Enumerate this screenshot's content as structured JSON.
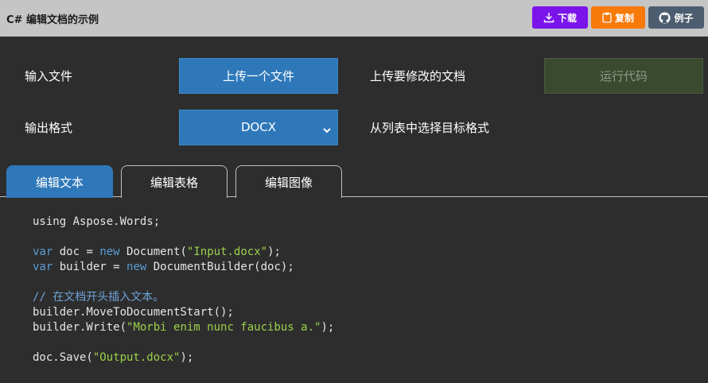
{
  "header": {
    "title": "C# 编辑文档的示例",
    "download_label": "下载",
    "copy_label": "复制",
    "examples_label": "例子"
  },
  "form": {
    "input_label": "输入文件",
    "upload_button": "上传一个文件",
    "upload_hint": "上传要修改的文档",
    "run_button": "运行代码",
    "output_label": "输出格式",
    "format_selected": "DOCX",
    "format_hint": "从列表中选择目标格式"
  },
  "tabs": [
    {
      "label": "编辑文本",
      "active": true
    },
    {
      "label": "编辑表格",
      "active": false
    },
    {
      "label": "编辑图像",
      "active": false
    }
  ],
  "code": {
    "l1_a": "using Aspose.Words;",
    "l2_kw": "var",
    "l2_a": " doc = ",
    "l2_kw2": "new",
    "l2_b": " Document(",
    "l2_str": "\"Input.docx\"",
    "l2_c": ");",
    "l3_kw": "var",
    "l3_a": " builder = ",
    "l3_kw2": "new",
    "l3_b": " DocumentBuilder(doc);",
    "l4_cm": "// 在文档开头插入文本。",
    "l5_a": "builder.MoveToDocumentStart();",
    "l6_a": "builder.Write(",
    "l6_str": "\"Morbi enim nunc faucibus a.\"",
    "l6_b": ");",
    "l7_a": "doc.Save(",
    "l7_str": "\"Output.docx\"",
    "l7_b": ");"
  },
  "colors": {
    "download": "#7b14ea",
    "copy": "#f6790a",
    "examples": "#4d5d70",
    "primary": "#2e78ba",
    "run_disabled": "#3a4a2f"
  }
}
